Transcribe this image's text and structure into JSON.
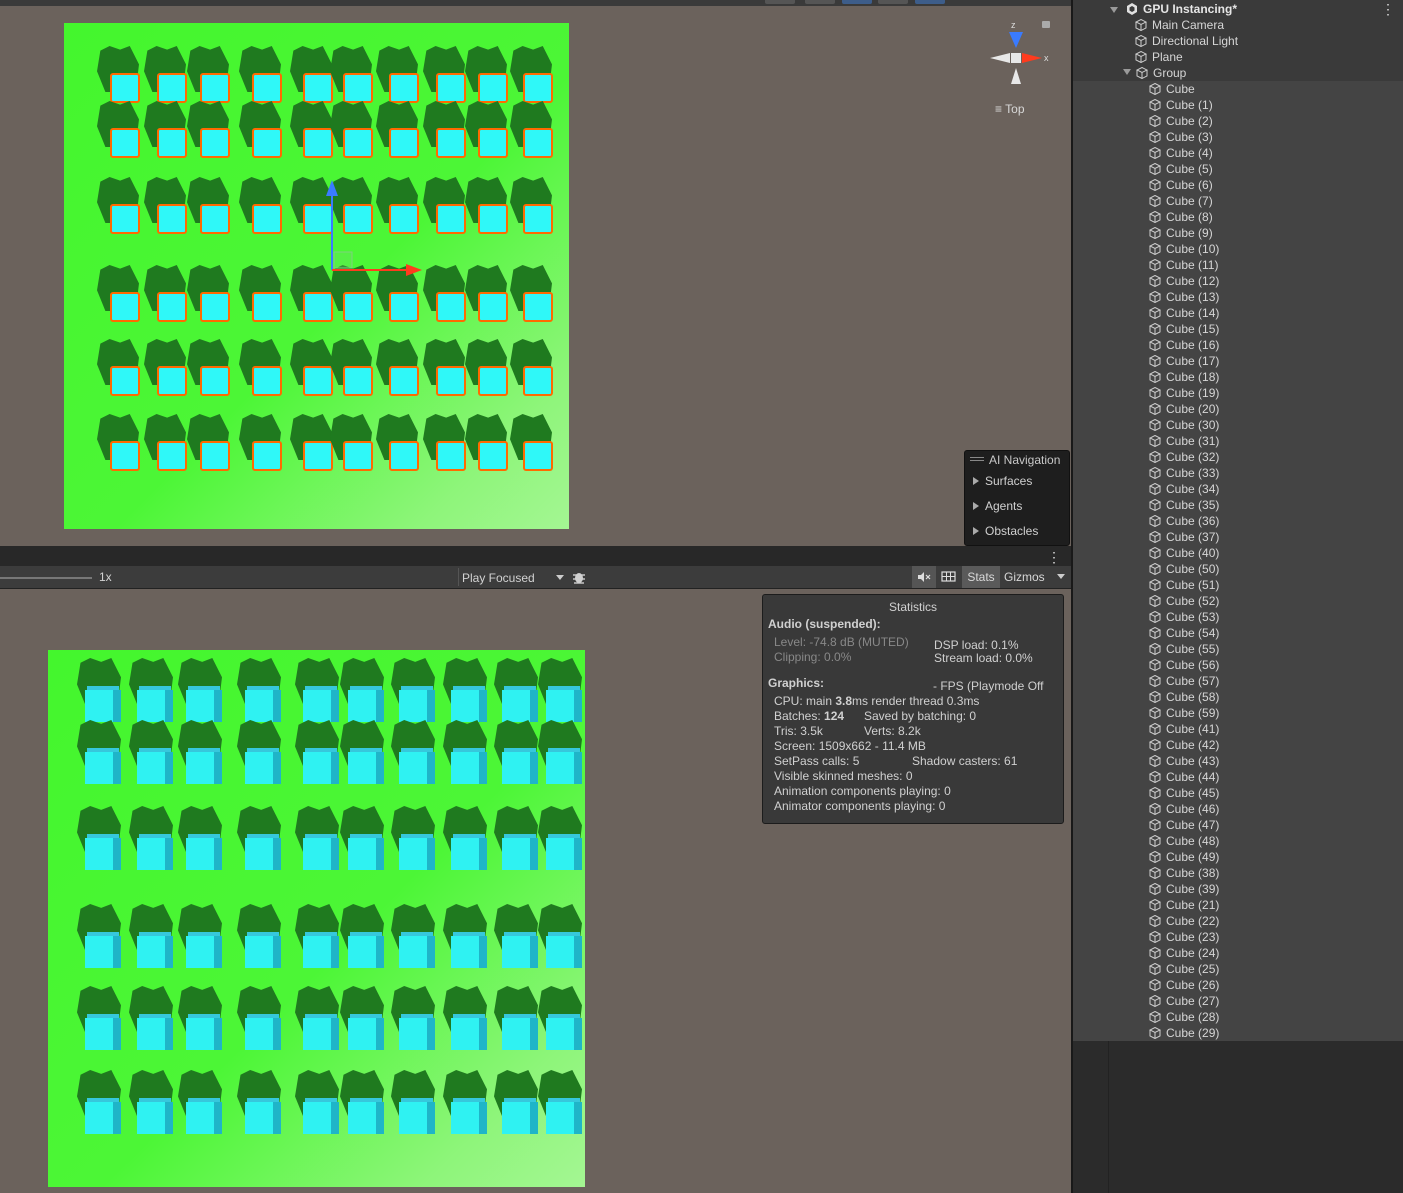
{
  "scene_view": {
    "orientation_label": "Top",
    "gizmo_axes": {
      "z": "z",
      "x": "x"
    },
    "ai_navigation": {
      "title": "AI Navigation",
      "items": [
        "Surfaces",
        "Agents",
        "Obstacles"
      ]
    }
  },
  "game_toolbar": {
    "scale": "1x",
    "play_mode": "Play Focused",
    "stats_label": "Stats",
    "gizmos_label": "Gizmos"
  },
  "statistics": {
    "title": "Statistics",
    "audio_header": "Audio (suspended):",
    "audio_level": "Level: -74.8 dB (MUTED)",
    "audio_clipping": "Clipping: 0.0%",
    "dsp_load": "DSP load: 0.1%",
    "stream_load": "Stream load: 0.0%",
    "graphics_header": "Graphics:",
    "fps": "- FPS (Playmode Off",
    "cpu_prefix": "CPU: main ",
    "cpu_main": "3.8",
    "cpu_suffix": "ms  render thread 0.3ms",
    "batches_prefix": "Batches: ",
    "batches": "124",
    "saved_by_batching": "Saved by batching: 0",
    "tris": "Tris: 3.5k",
    "verts": "Verts: 8.2k",
    "screen": "Screen: 1509x662 - 11.4 MB",
    "setpass": "SetPass calls: 5",
    "shadow_casters": "Shadow casters: 61",
    "skinned": "Visible skinned meshes: 0",
    "animation": "Animation components playing: 0",
    "animator": "Animator components playing: 0"
  },
  "hierarchy": {
    "scene_name": "GPU Instancing*",
    "root_items": [
      "Main Camera",
      "Directional Light",
      "Plane"
    ],
    "group_name": "Group",
    "group_children": [
      "Cube",
      "Cube (1)",
      "Cube (2)",
      "Cube (3)",
      "Cube (4)",
      "Cube (5)",
      "Cube (6)",
      "Cube (7)",
      "Cube (8)",
      "Cube (9)",
      "Cube (10)",
      "Cube (11)",
      "Cube (12)",
      "Cube (13)",
      "Cube (14)",
      "Cube (15)",
      "Cube (16)",
      "Cube (17)",
      "Cube (18)",
      "Cube (19)",
      "Cube (20)",
      "Cube (30)",
      "Cube (31)",
      "Cube (32)",
      "Cube (33)",
      "Cube (34)",
      "Cube (35)",
      "Cube (36)",
      "Cube (37)",
      "Cube (40)",
      "Cube (50)",
      "Cube (51)",
      "Cube (52)",
      "Cube (53)",
      "Cube (54)",
      "Cube (55)",
      "Cube (56)",
      "Cube (57)",
      "Cube (58)",
      "Cube (59)",
      "Cube (41)",
      "Cube (42)",
      "Cube (43)",
      "Cube (44)",
      "Cube (45)",
      "Cube (46)",
      "Cube (47)",
      "Cube (48)",
      "Cube (49)",
      "Cube (38)",
      "Cube (39)",
      "Cube (21)",
      "Cube (22)",
      "Cube (23)",
      "Cube (24)",
      "Cube (25)",
      "Cube (26)",
      "Cube (27)",
      "Cube (28)",
      "Cube (29)"
    ]
  },
  "colors": {
    "plane_green": "#44f62d",
    "cube_cyan": "#2ff8f8",
    "selection_outline": "#ff6a00",
    "shadow_green": "#1f7a1f"
  }
}
